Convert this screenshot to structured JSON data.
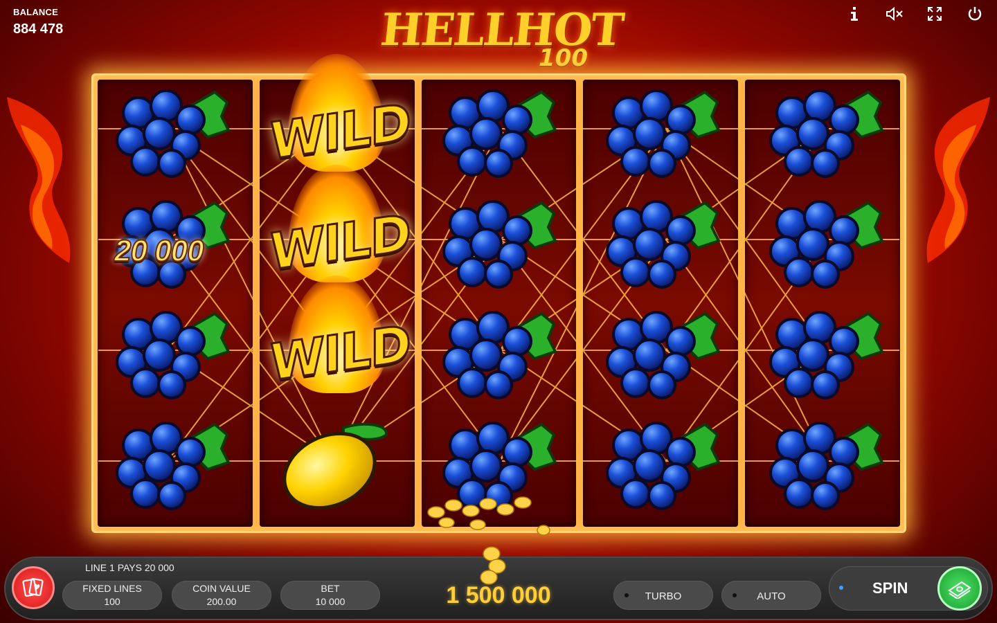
{
  "balance": {
    "label": "BALANCE",
    "value": "884 478"
  },
  "logo": {
    "title": "HELLHOT",
    "number": "100"
  },
  "top_icons": [
    "info-icon",
    "sound-muted-icon",
    "fullscreen-icon",
    "power-icon"
  ],
  "reels": [
    [
      "grapes",
      "grapes",
      "grapes",
      "grapes"
    ],
    [
      "wild",
      "wild",
      "wild",
      "lemon"
    ],
    [
      "grapes",
      "grapes",
      "grapes",
      "grapes"
    ],
    [
      "grapes",
      "grapes",
      "grapes",
      "grapes"
    ],
    [
      "grapes",
      "grapes",
      "grapes",
      "grapes"
    ]
  ],
  "wild_label": "WILD",
  "win_on_symbol": "20 000",
  "bottom": {
    "line_message": "LINE 1 PAYS 20 000",
    "fixed_lines": {
      "label": "FIXED LINES",
      "value": "100"
    },
    "coin_value": {
      "label": "COIN VALUE",
      "value": "200.00"
    },
    "bet": {
      "label": "BET",
      "value": "10 000"
    },
    "total_win": "1 500 000",
    "turbo_label": "TURBO",
    "auto_label": "AUTO",
    "spin_label": "SPIN"
  },
  "colors": {
    "accent_gold": "#ffcf3a",
    "spin_green": "#18a02c",
    "home_red": "#d91616"
  }
}
